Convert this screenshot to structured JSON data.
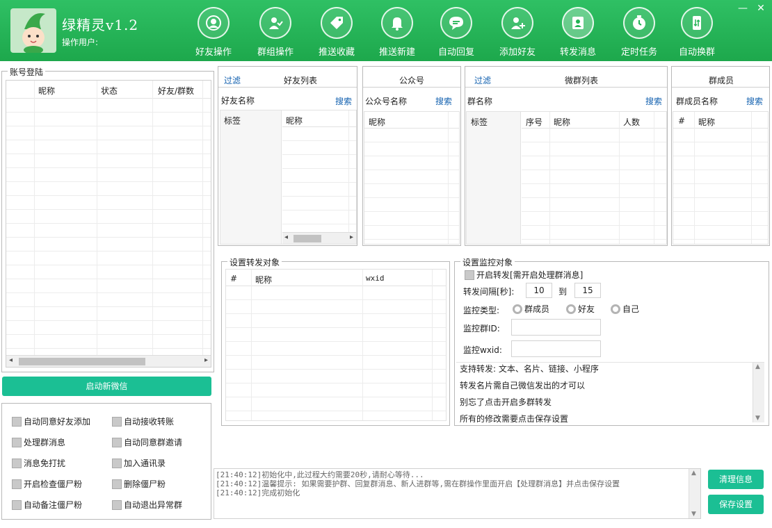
{
  "app": {
    "title": "绿精灵v1.2",
    "user_label": "操作用户:"
  },
  "nav": [
    {
      "label": "好友操作",
      "icon": "friend-icon"
    },
    {
      "label": "群组操作",
      "icon": "group-icon"
    },
    {
      "label": "推送收藏",
      "icon": "tag-icon"
    },
    {
      "label": "推送新建",
      "icon": "bell-icon"
    },
    {
      "label": "自动回复",
      "icon": "chat-icon"
    },
    {
      "label": "添加好友",
      "icon": "add-user-icon"
    },
    {
      "label": "转发消息",
      "icon": "forward-icon"
    },
    {
      "label": "定时任务",
      "icon": "clock-icon"
    },
    {
      "label": "自动换群",
      "icon": "switch-icon"
    }
  ],
  "account": {
    "title": "账号登陆",
    "columns": [
      "昵称",
      "状态",
      "好友/群数"
    ]
  },
  "start_button": "启动新微信",
  "options": [
    [
      "自动同意好友添加",
      "自动接收转账"
    ],
    [
      "处理群消息",
      "自动同意群邀请"
    ],
    [
      "消息免打扰",
      "加入通讯录"
    ],
    [
      "开启检查僵尸粉",
      "删除僵尸粉"
    ],
    [
      "自动备注僵尸粉",
      "自动退出异常群"
    ]
  ],
  "friends": {
    "filter": "过滤",
    "title": "好友列表",
    "search_label": "好友名称",
    "search": "搜索",
    "col_tag": "标签",
    "col_nick": "昵称"
  },
  "official": {
    "title": "公众号",
    "search_label": "公众号名称",
    "search": "搜索",
    "col_nick": "昵称"
  },
  "groups": {
    "filter": "过滤",
    "title": "微群列表",
    "search_label": "群名称",
    "search": "搜索",
    "columns": [
      "标签",
      "序号",
      "昵称",
      "人数"
    ]
  },
  "members": {
    "title": "群成员",
    "search_label": "群成员名称",
    "search": "搜索",
    "columns": [
      "#",
      "昵称"
    ]
  },
  "forward_targets": {
    "title": "设置转发对象",
    "columns": [
      "#",
      "昵称",
      "wxid"
    ]
  },
  "monitor": {
    "title": "设置监控对象",
    "enable": "开启转发[需开启处理群消息]",
    "interval_label": "转发间隔[秒]:",
    "from": "10",
    "to_label": "到",
    "to": "15",
    "type_label": "监控类型:",
    "types": [
      "群成员",
      "好友",
      "自己"
    ],
    "group_id_label": "监控群ID:",
    "wxid_label": "监控wxid:",
    "notes": [
      "支持转发: 文本、名片、链接、小程序",
      "转发名片需自己微信发出的才可以",
      "别忘了点击开启多群转发",
      "所有的修改需要点击保存设置"
    ]
  },
  "log": [
    "[21:40:12]初始化中,此过程大约需要20秒,请耐心等待...",
    "[21:40:12]温馨提示: 如果需要护群、回复群消息、新人进群等,需在群操作里面开启【处理群消息】并点击保存设置",
    "[21:40:12]完成初始化"
  ],
  "buttons": {
    "clear": "清理信息",
    "save": "保存设置"
  },
  "colors": {
    "header": "#22b354",
    "accent": "#1bbf94",
    "link": "#1462b0"
  }
}
